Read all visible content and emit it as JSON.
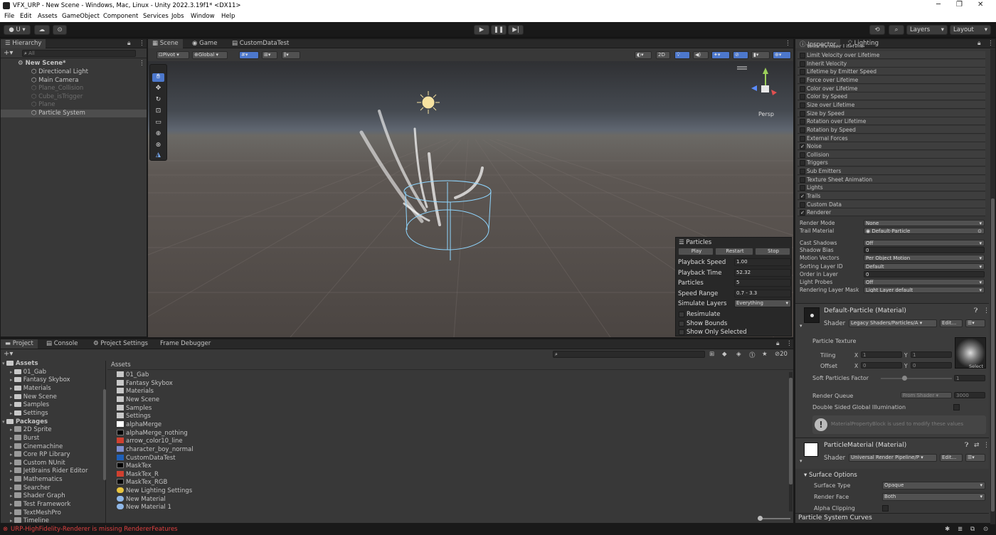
{
  "window": {
    "title": "VFX_URP - New Scene - Windows, Mac, Linux - Unity 2022.3.19f1* <DX11>"
  },
  "menu": [
    "File",
    "Edit",
    "Assets",
    "GameObject",
    "Component",
    "Services",
    "Jobs",
    "Window",
    "Help"
  ],
  "toolbar": {
    "account": "U",
    "layers": "Layers",
    "layout": "Layout"
  },
  "hierarchy": {
    "tab": "Hierarchy",
    "search_placeholder": "All",
    "scene": "New Scene*",
    "items": [
      {
        "label": "Directional Light",
        "active": true
      },
      {
        "label": "Main Camera",
        "active": true
      },
      {
        "label": "Plane_Collision",
        "active": false
      },
      {
        "label": "Cube_isTrigger",
        "active": false
      },
      {
        "label": "Plane",
        "active": false
      },
      {
        "label": "Particle System",
        "active": true
      }
    ]
  },
  "scene_tabs": [
    "Scene",
    "Game",
    "CustomDataTest"
  ],
  "scene_toolbar": {
    "pivot": "Pivot",
    "global": "Global",
    "mode_2d": "2D",
    "persp": "Persp"
  },
  "particles_overlay": {
    "title": "Particles",
    "buttons": [
      "Play",
      "Restart",
      "Stop"
    ],
    "rows": [
      {
        "label": "Playback Speed",
        "value": "1.00"
      },
      {
        "label": "Playback Time",
        "value": "52.32"
      },
      {
        "label": "Particles",
        "value": "5"
      },
      {
        "label": "Speed Range",
        "value": "0.7 - 3.3"
      },
      {
        "label": "Simulate Layers",
        "value": "Everything"
      }
    ],
    "checks": [
      "Resimulate",
      "Show Bounds",
      "Show Only Selected"
    ]
  },
  "inspector": {
    "tabs": [
      "Inspector",
      "Lighting"
    ],
    "partial_top": "Velocity over Lifetime",
    "modules": [
      {
        "label": "Limit Velocity over Lifetime",
        "checked": false
      },
      {
        "label": "Inherit Velocity",
        "checked": false
      },
      {
        "label": "Lifetime by Emitter Speed",
        "checked": false
      },
      {
        "label": "Force over Lifetime",
        "checked": false
      },
      {
        "label": "Color over Lifetime",
        "checked": false
      },
      {
        "label": "Color by Speed",
        "checked": false
      },
      {
        "label": "Size over Lifetime",
        "checked": false
      },
      {
        "label": "Size by Speed",
        "checked": false
      },
      {
        "label": "Rotation over Lifetime",
        "checked": false
      },
      {
        "label": "Rotation by Speed",
        "checked": false
      },
      {
        "label": "External Forces",
        "checked": false
      },
      {
        "label": "Noise",
        "checked": true
      },
      {
        "label": "Collision",
        "checked": false
      },
      {
        "label": "Triggers",
        "checked": false
      },
      {
        "label": "Sub Emitters",
        "checked": false
      },
      {
        "label": "Texture Sheet Animation",
        "checked": false
      },
      {
        "label": "Lights",
        "checked": false
      },
      {
        "label": "Trails",
        "checked": true
      },
      {
        "label": "Custom Data",
        "checked": false
      },
      {
        "label": "Renderer",
        "checked": true
      }
    ],
    "renderer": [
      {
        "label": "Render Mode",
        "value": "None"
      },
      {
        "label": "Trail Material",
        "value": "Default-Particle"
      },
      {
        "label": "Cast Shadows",
        "value": "Off"
      },
      {
        "label": "Shadow Bias",
        "value": "0"
      },
      {
        "label": "Motion Vectors",
        "value": "Per Object Motion"
      },
      {
        "label": "Sorting Layer ID",
        "value": "Default"
      },
      {
        "label": "Order in Layer",
        "value": "0"
      },
      {
        "label": "Light Probes",
        "value": "Off"
      },
      {
        "label": "Rendering Layer Mask",
        "value": "Light Layer default"
      }
    ],
    "material1": {
      "name": "Default-Particle (Material)",
      "shader_label": "Shader",
      "shader": "Legacy Shaders/Particles/A",
      "edit": "Edit...",
      "particle_texture": "Particle Texture",
      "tiling": "Tiling",
      "offset": "Offset",
      "tiling_x": "1",
      "tiling_y": "1",
      "offset_x": "0",
      "offset_y": "0",
      "select": "Select",
      "soft_particles": "Soft Particles Factor",
      "soft_value": "1",
      "render_queue": "Render Queue",
      "render_queue_mode": "From Shader",
      "render_queue_value": "3000",
      "double_sided": "Double Sided Global Illumination",
      "info": "MaterialPropertyBlock is used to modify these values"
    },
    "material2": {
      "name": "ParticleMaterial (Material)",
      "shader_label": "Shader",
      "shader": "Universal Render Pipeline/P",
      "edit": "Edit...",
      "surface_options": "Surface Options",
      "surface_type_label": "Surface Type",
      "surface_type": "Opaque",
      "render_face_label": "Render Face",
      "render_face": "Both",
      "alpha_clipping": "Alpha Clipping"
    },
    "curves": "Particle System Curves"
  },
  "bottom_tabs": [
    "Project",
    "Console",
    "Project Settings",
    "Frame Debugger"
  ],
  "project": {
    "tree": [
      {
        "label": "Assets",
        "bold": true,
        "indent": 0
      },
      {
        "label": "01_Gab",
        "bold": false,
        "indent": 1
      },
      {
        "label": "Fantasy Skybox",
        "bold": false,
        "indent": 1
      },
      {
        "label": "Materials",
        "bold": false,
        "indent": 1
      },
      {
        "label": "New Scene",
        "bold": false,
        "indent": 1
      },
      {
        "label": "Samples",
        "bold": false,
        "indent": 1
      },
      {
        "label": "Settings",
        "bold": false,
        "indent": 1
      },
      {
        "label": "Packages",
        "bold": true,
        "indent": 0
      },
      {
        "label": "2D Sprite",
        "bold": false,
        "indent": 1
      },
      {
        "label": "Burst",
        "bold": false,
        "indent": 1
      },
      {
        "label": "Cinemachine",
        "bold": false,
        "indent": 1
      },
      {
        "label": "Core RP Library",
        "bold": false,
        "indent": 1
      },
      {
        "label": "Custom NUnit",
        "bold": false,
        "indent": 1
      },
      {
        "label": "JetBrains Rider Editor",
        "bold": false,
        "indent": 1
      },
      {
        "label": "Mathematics",
        "bold": false,
        "indent": 1
      },
      {
        "label": "Searcher",
        "bold": false,
        "indent": 1
      },
      {
        "label": "Shader Graph",
        "bold": false,
        "indent": 1
      },
      {
        "label": "Test Framework",
        "bold": false,
        "indent": 1
      },
      {
        "label": "TextMeshPro",
        "bold": false,
        "indent": 1
      },
      {
        "label": "Timeline",
        "bold": false,
        "indent": 1
      }
    ],
    "breadcrumb": "Assets",
    "assets": [
      {
        "label": "01_Gab",
        "kind": "folder"
      },
      {
        "label": "Fantasy Skybox",
        "kind": "folder"
      },
      {
        "label": "Materials",
        "kind": "folder"
      },
      {
        "label": "New Scene",
        "kind": "folder"
      },
      {
        "label": "Samples",
        "kind": "folder"
      },
      {
        "label": "Settings",
        "kind": "folder"
      },
      {
        "label": "alphaMerge",
        "kind": "white"
      },
      {
        "label": "alphaMerge_nothing",
        "kind": "black"
      },
      {
        "label": "arrow_color10_line",
        "kind": "red"
      },
      {
        "label": "character_boy_normal",
        "kind": "tex"
      },
      {
        "label": "CustomDataTest",
        "kind": "cs"
      },
      {
        "label": "MaskTex",
        "kind": "black"
      },
      {
        "label": "MaskTex_R",
        "kind": "red"
      },
      {
        "label": "MaskTex_RGB",
        "kind": "black"
      },
      {
        "label": "New Lighting Settings",
        "kind": "light"
      },
      {
        "label": "New Material",
        "kind": "mat"
      },
      {
        "label": "New Material 1",
        "kind": "mat"
      }
    ],
    "hidden_count": "20"
  },
  "status": {
    "message": "URP-HighFidelity-Renderer is missing RendererFeatures"
  },
  "colors": {
    "accent": "#4d78cc",
    "panel": "#383838",
    "error": "#e04040"
  }
}
